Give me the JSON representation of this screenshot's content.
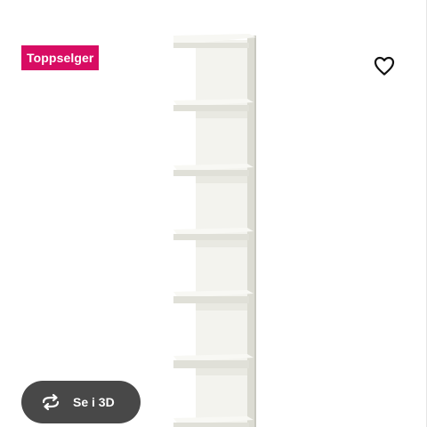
{
  "product": {
    "badge_label": "Toppselger",
    "image_name": "wall-shelf-unit"
  },
  "actions": {
    "view_3d_label": "Se i 3D",
    "favorite_icon": "heart-icon",
    "view_3d_icon": "rotate-icon"
  },
  "colors": {
    "badge_bg": "#d80c63",
    "button_bg": "#484848",
    "shelf_light": "#f3f3ee",
    "shelf_mid": "#e4e4dc",
    "shelf_shadow": "#cfcfc6"
  }
}
